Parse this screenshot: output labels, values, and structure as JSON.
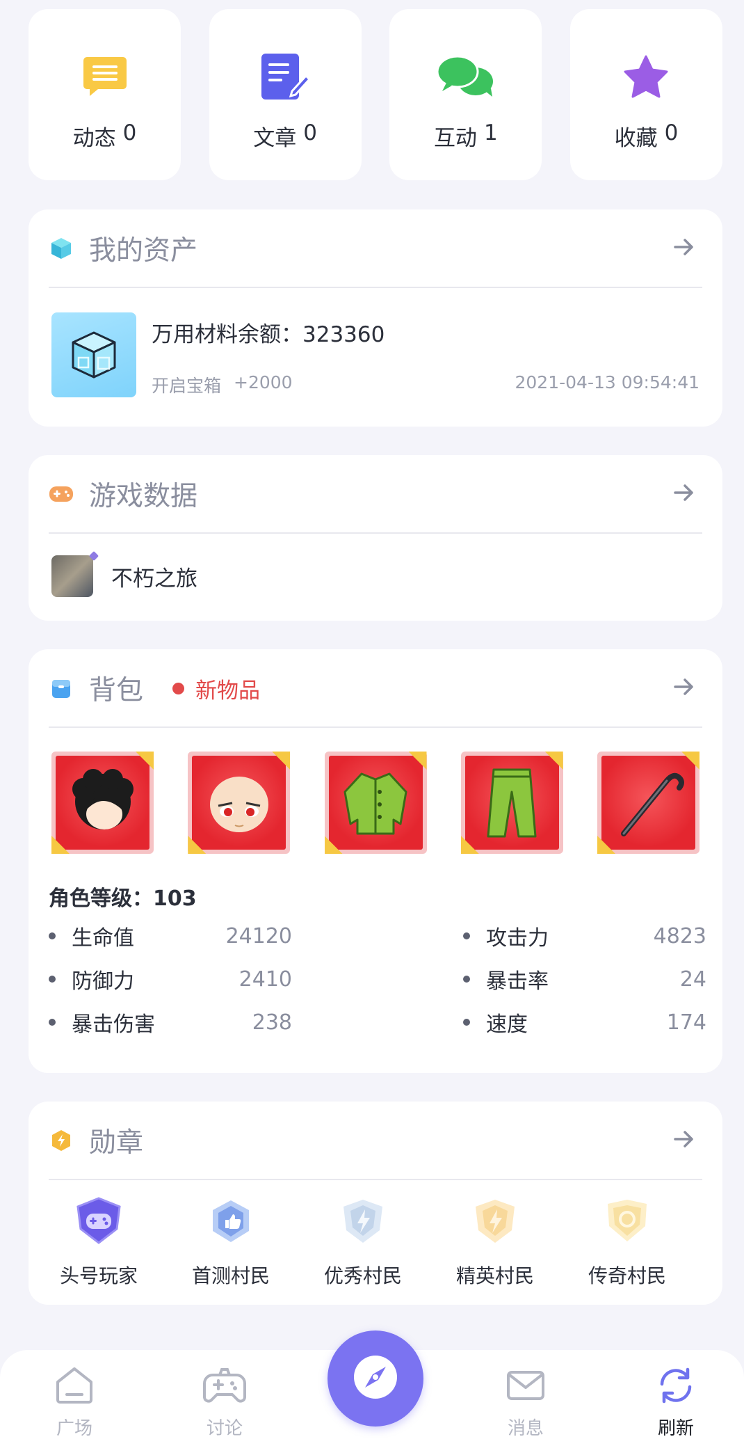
{
  "stats": [
    {
      "label": "动态",
      "count": "0",
      "icon": "list-icon",
      "color": "#f9c945"
    },
    {
      "label": "文章",
      "count": "0",
      "icon": "article-icon",
      "color": "#5c60ec"
    },
    {
      "label": "互动",
      "count": "1",
      "icon": "chat-icon",
      "color": "#3cc25e"
    },
    {
      "label": "收藏",
      "count": "0",
      "icon": "star-icon",
      "color": "#9b5de5"
    }
  ],
  "assets": {
    "title": "我的资产",
    "balance_label": "万用材料余额：323360",
    "source": "开启宝箱",
    "delta": "+2000",
    "time": "2021-04-13 09:54:41"
  },
  "game": {
    "title": "游戏数据",
    "name": "不朽之旅"
  },
  "backpack": {
    "title": "背包",
    "new_label": "新物品",
    "items": [
      "hair-item",
      "face-item",
      "jacket-item",
      "pants-item",
      "cane-item"
    ],
    "level": "角色等级：103",
    "attrs": [
      {
        "name": "生命值",
        "value": "24120"
      },
      {
        "name": "攻击力",
        "value": "4823"
      },
      {
        "name": "防御力",
        "value": "2410"
      },
      {
        "name": "暴击率",
        "value": "24"
      },
      {
        "name": "暴击伤害",
        "value": "238"
      },
      {
        "name": "速度",
        "value": "174"
      }
    ]
  },
  "medals": {
    "title": "勋章",
    "items": [
      {
        "label": "头号玩家",
        "icon": "gamepad-badge-icon"
      },
      {
        "label": "首测村民",
        "icon": "thumbs-up-badge-icon"
      },
      {
        "label": "优秀村民",
        "icon": "silver-bolt-badge-icon"
      },
      {
        "label": "精英村民",
        "icon": "gold-bolt-badge-icon"
      },
      {
        "label": "传奇村民",
        "icon": "legend-badge-icon"
      }
    ]
  },
  "nav": [
    {
      "label": "广场",
      "icon": "home-icon"
    },
    {
      "label": "讨论",
      "icon": "gamepad-icon"
    },
    {
      "label": "",
      "icon": "compass-icon"
    },
    {
      "label": "消息",
      "icon": "mail-icon"
    },
    {
      "label": "刷新",
      "icon": "refresh-icon"
    }
  ],
  "colors": {
    "accent": "#7b73f1",
    "new": "#e24a4a",
    "background": "#f4f4fa"
  }
}
